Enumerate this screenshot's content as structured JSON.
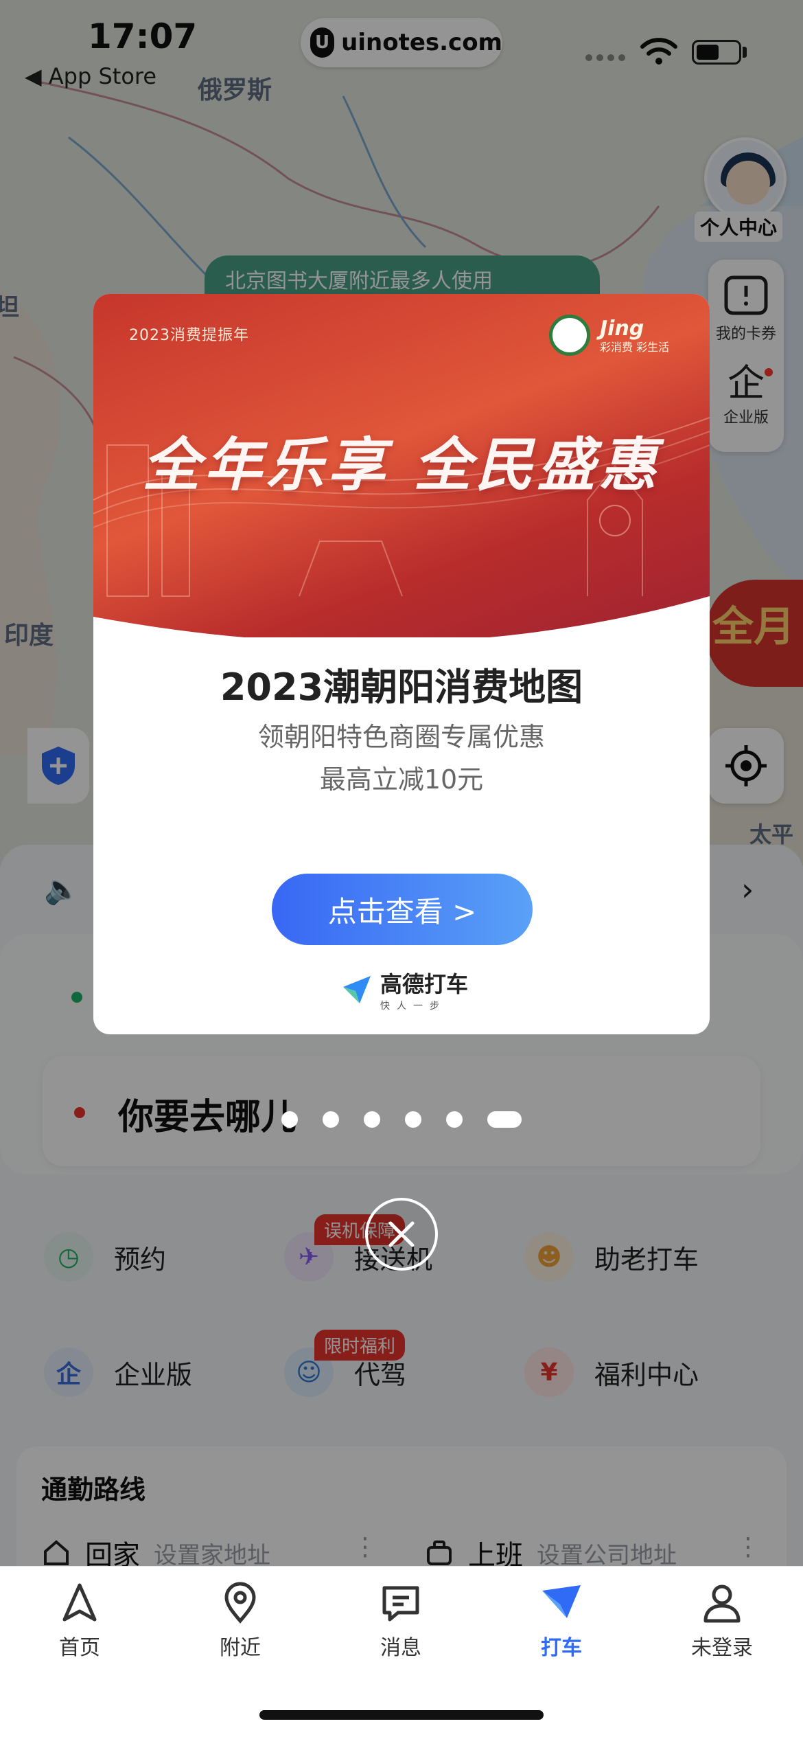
{
  "status_bar": {
    "time": "17:07",
    "back_label": "◀ App Store",
    "url": "uinotes.com",
    "wifi_icon": "wifi-icon",
    "battery_icon": "battery-icon"
  },
  "map": {
    "labels": [
      "俄罗斯",
      "印度",
      "太平",
      "坦"
    ],
    "hint_pill": "北京图书大厦附近最多人使用",
    "promo_badge": "全月"
  },
  "right_controls": {
    "avatar_label": "个人中心",
    "cards_label": "我的卡券",
    "enterprise_label": "企业版",
    "enterprise_icon_text": "企",
    "notification_color": "#ff3b30"
  },
  "modal": {
    "banner_year_text": "2023消费提振年",
    "banner_logo_text": "Jing",
    "banner_logo_sub": "彩消费 彩生活",
    "banner_headline": "全年乐享 全民盛惠",
    "title": "2023潮朝阳消费地图",
    "subtitle_line1": "领朝阳特色商圈专属优惠",
    "subtitle_line2": "最高立减10元",
    "cta_label": "点击查看 >",
    "brand_name": "高德打车",
    "brand_slogan": "快人一步",
    "cta_gradient_start": "#3867f4",
    "cta_gradient_end": "#5aa1f7"
  },
  "carousel": {
    "dot_count": 6,
    "active_index": 5
  },
  "sheet": {
    "destination_placeholder": "你要去哪儿",
    "services": [
      {
        "label": "预约",
        "icon": "clock-icon",
        "tag": ""
      },
      {
        "label": "接送机",
        "icon": "plane-icon",
        "tag": "误机保障"
      },
      {
        "label": "助老打车",
        "icon": "elder-icon",
        "tag": ""
      },
      {
        "label": "企业版",
        "icon": "enterprise-icon",
        "tag": ""
      },
      {
        "label": "代驾",
        "icon": "driver-icon",
        "tag": "限时福利"
      },
      {
        "label": "福利中心",
        "icon": "moneybag-icon",
        "tag": ""
      }
    ],
    "commute": {
      "title": "通勤路线",
      "home_label": "回家",
      "home_placeholder": "设置家地址",
      "work_label": "上班",
      "work_placeholder": "设置公司地址"
    }
  },
  "tabbar": {
    "tabs": [
      {
        "label": "首页",
        "icon": "navigation-arrow-icon"
      },
      {
        "label": "附近",
        "icon": "location-pin-icon"
      },
      {
        "label": "消息",
        "icon": "message-icon"
      },
      {
        "label": "打车",
        "icon": "taxi-icon"
      },
      {
        "label": "未登录",
        "icon": "user-icon"
      }
    ],
    "active_index": 3,
    "active_color": "#2f6bf4"
  }
}
